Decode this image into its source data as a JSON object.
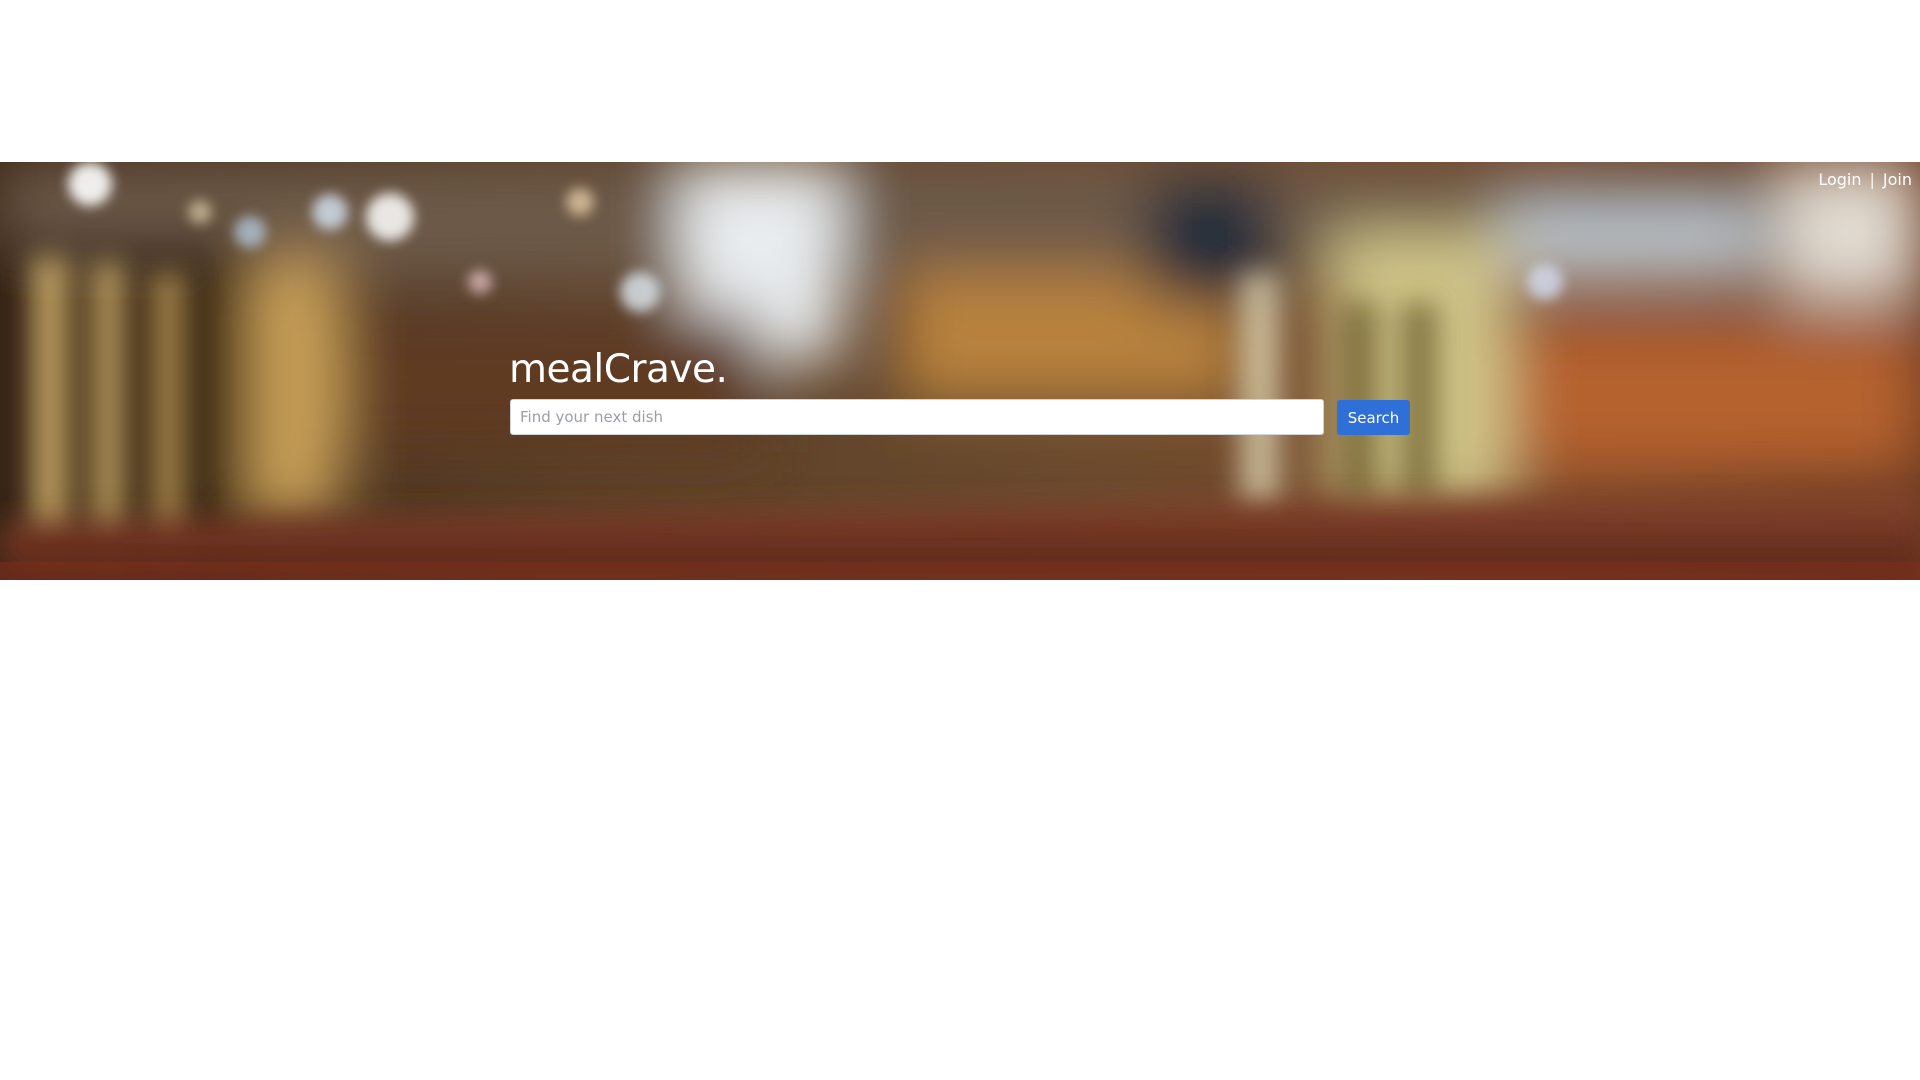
{
  "header": {
    "login_label": "Login",
    "separator": "|",
    "join_label": "Join"
  },
  "hero": {
    "brand": "mealCrave.",
    "background": "blurred-restaurant-interior-photo"
  },
  "search": {
    "placeholder": "Find your next dish",
    "value": "",
    "button_label": "Search"
  },
  "colors": {
    "accent": "#2f6fd8",
    "text_on_hero": "#ffffff",
    "page_background": "#ffffff"
  }
}
